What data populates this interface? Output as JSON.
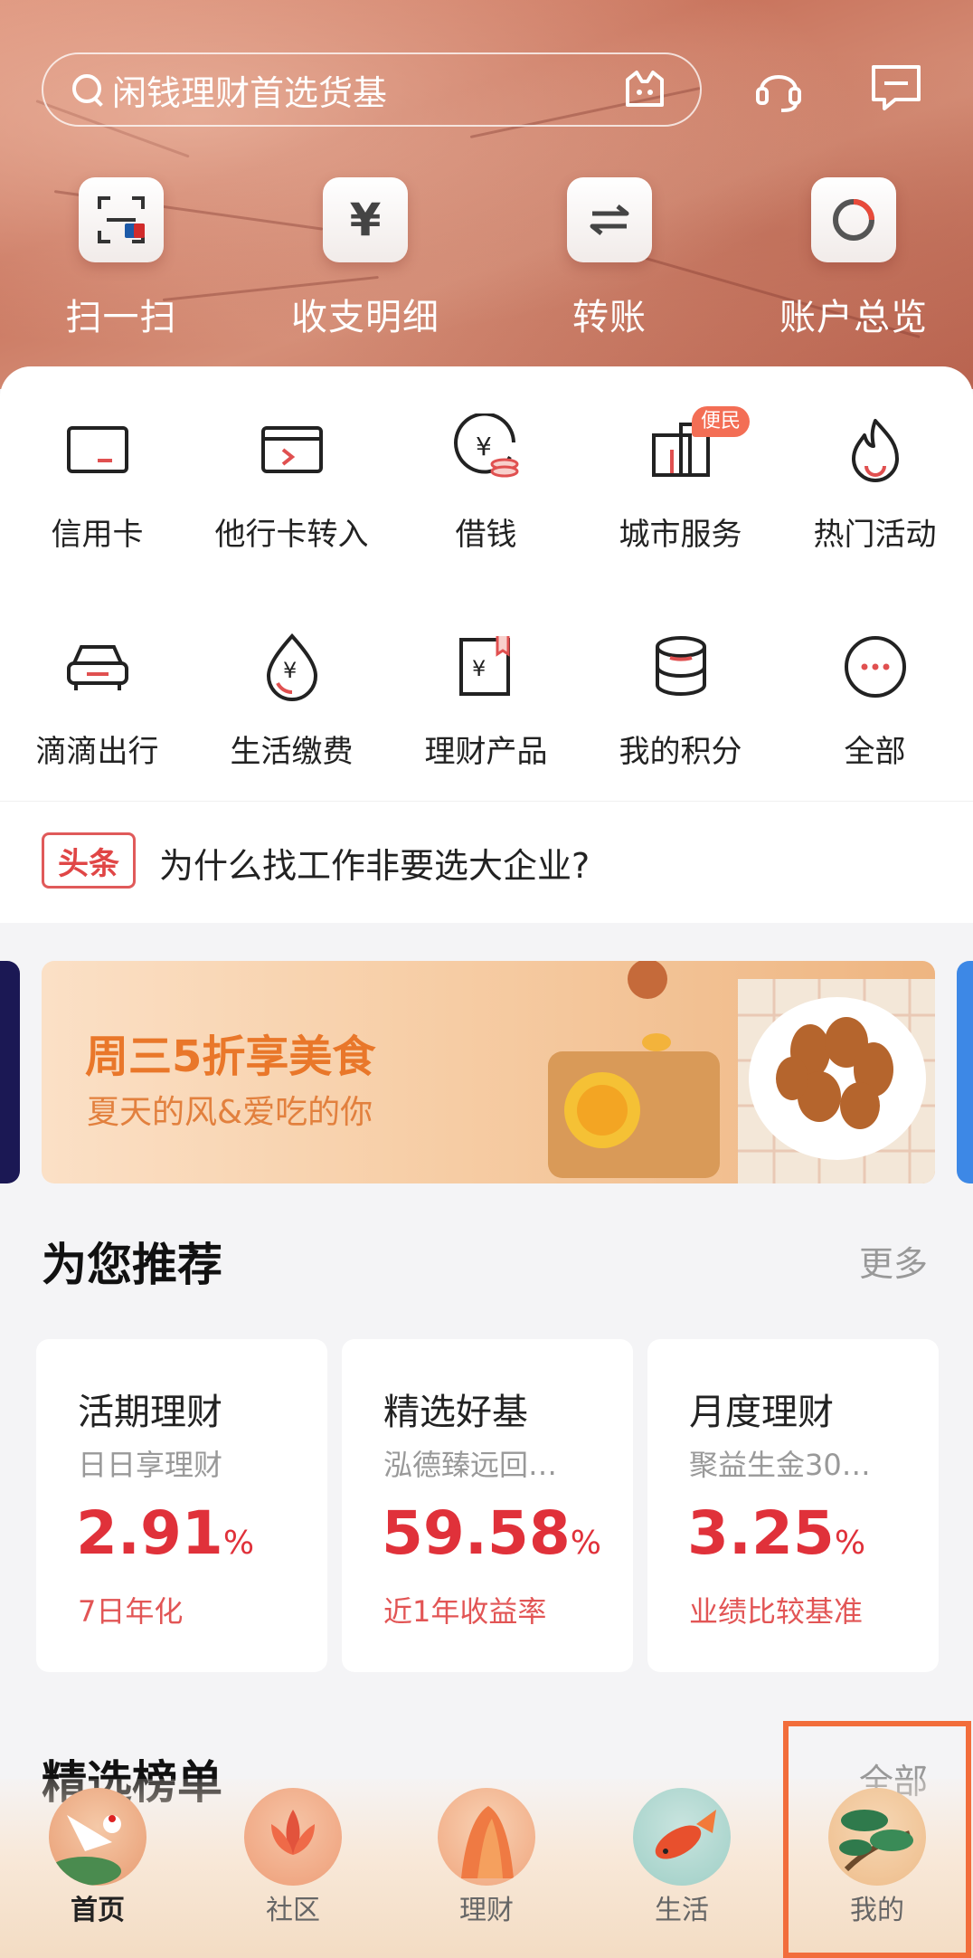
{
  "header": {
    "search_placeholder": "闲钱理财首选货基",
    "quick_actions": [
      {
        "label": "扫一扫",
        "icon": "scan-icon"
      },
      {
        "label": "收支明细",
        "icon": "yuan-icon"
      },
      {
        "label": "转账",
        "icon": "transfer-icon"
      },
      {
        "label": "账户总览",
        "icon": "account-overview-icon"
      }
    ]
  },
  "services": [
    {
      "label": "信用卡",
      "icon": "credit-card-icon"
    },
    {
      "label": "他行卡转入",
      "icon": "card-transfer-in-icon"
    },
    {
      "label": "借钱",
      "icon": "loan-icon"
    },
    {
      "label": "城市服务",
      "icon": "city-service-icon",
      "badge": "便民"
    },
    {
      "label": "热门活动",
      "icon": "flame-icon"
    },
    {
      "label": "滴滴出行",
      "icon": "car-icon"
    },
    {
      "label": "生活缴费",
      "icon": "bill-payment-icon"
    },
    {
      "label": "理财产品",
      "icon": "wealth-product-icon"
    },
    {
      "label": "我的积分",
      "icon": "points-icon"
    },
    {
      "label": "全部",
      "icon": "more-icon"
    }
  ],
  "news": {
    "tag": "头条",
    "text": "为什么找工作非要选大企业?"
  },
  "banner": {
    "title": "周三5折享美食",
    "subtitle": "夏天的风&爱吃的你"
  },
  "recommend": {
    "title": "为您推荐",
    "more": "更多",
    "items": [
      {
        "name": "活期理财",
        "desc": "日日享理财",
        "rate": "2.91",
        "unit": "%",
        "foot": "7日年化"
      },
      {
        "name": "精选好基",
        "desc": "泓德臻远回…",
        "rate": "59.58",
        "unit": "%",
        "foot": "近1年收益率"
      },
      {
        "name": "月度理财",
        "desc": "聚益生金30…",
        "rate": "3.25",
        "unit": "%",
        "foot": "业绩比较基准"
      }
    ]
  },
  "ranking": {
    "title": "精选榜单",
    "more": "全部"
  },
  "nav": [
    {
      "label": "首页",
      "active": true
    },
    {
      "label": "社区",
      "active": false
    },
    {
      "label": "理财",
      "active": false
    },
    {
      "label": "生活",
      "active": false
    },
    {
      "label": "我的",
      "active": false
    }
  ],
  "colors": {
    "accent": "#e0313a",
    "highlight": "#f26d3b"
  }
}
